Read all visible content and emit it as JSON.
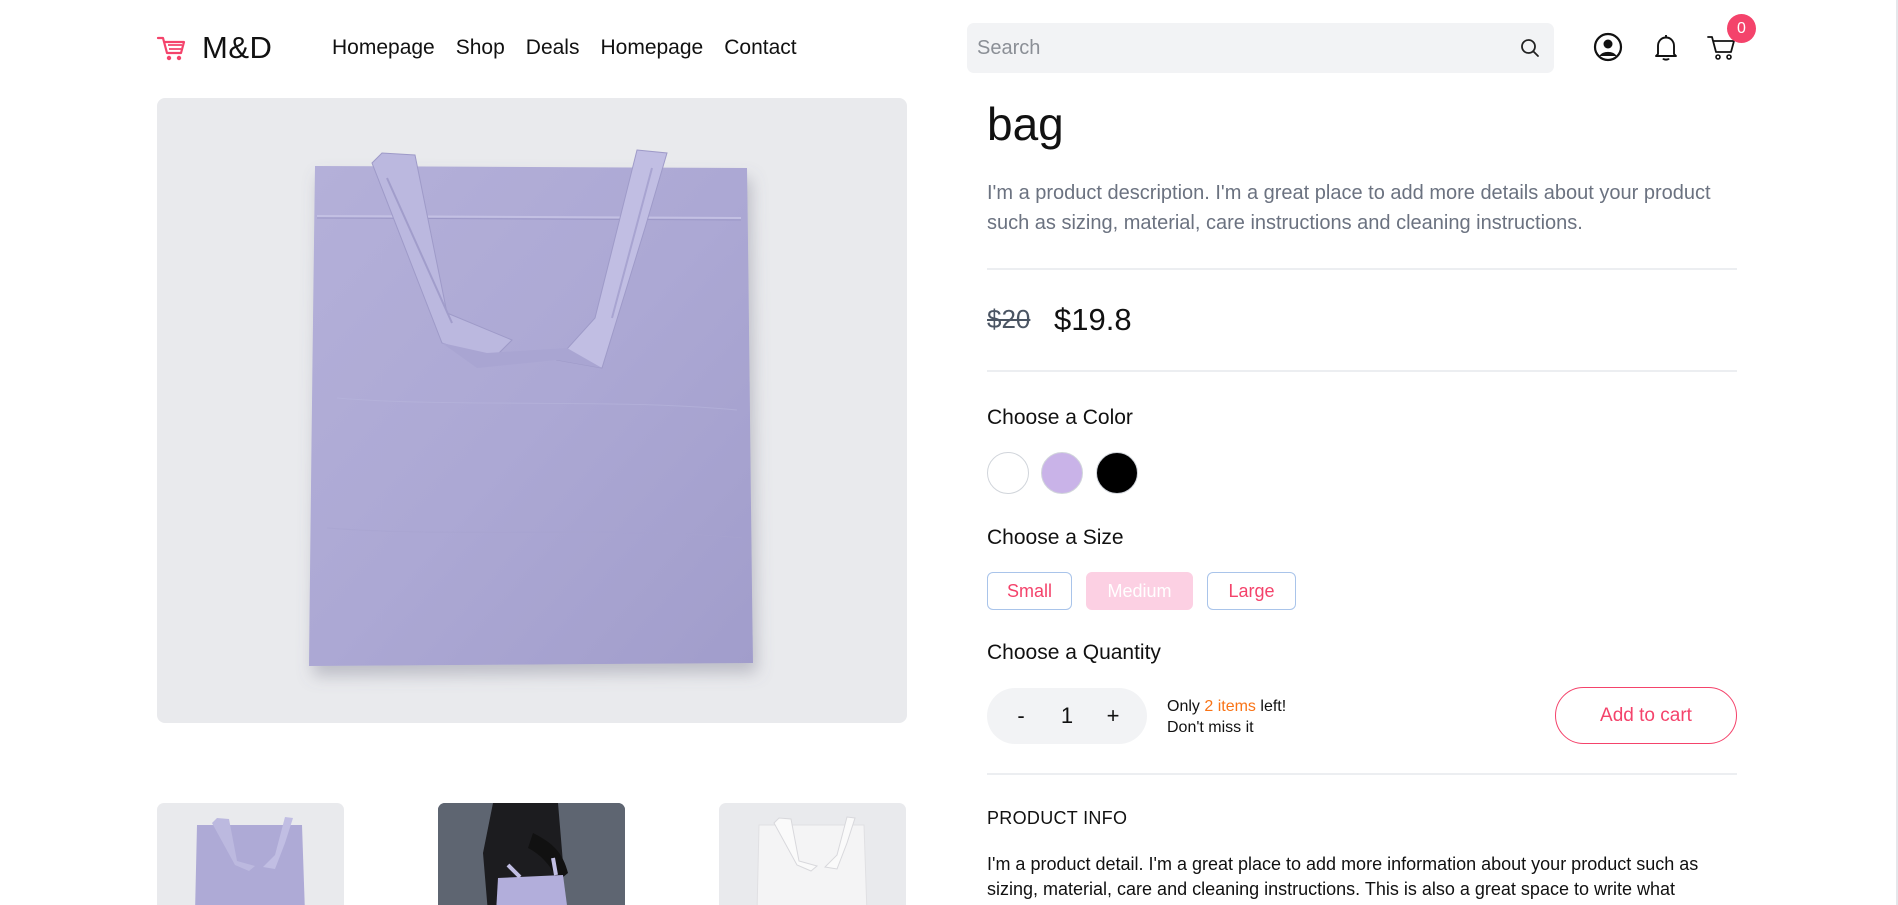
{
  "brand": {
    "name": "M&D",
    "icon": "shopping-cart-icon",
    "accent": "#f4436b"
  },
  "nav": {
    "items": [
      "Homepage",
      "Shop",
      "Deals",
      "Homepage",
      "Contact"
    ]
  },
  "search": {
    "placeholder": "Search",
    "value": "",
    "icon": "search-icon"
  },
  "header_icons": {
    "user": "user-circle-icon",
    "notifications": "bell-icon",
    "cart": "cart-icon",
    "cart_count": "0"
  },
  "product": {
    "title": "bag",
    "description": "I'm a product description. I'm a great place to add more details about your product such as sizing, material, care instructions and cleaning instructions.",
    "price_old": "$20",
    "price_new": "$19.8",
    "color_label": "Choose a Color",
    "colors": [
      "#ffffff",
      "#c9b3e8",
      "#000000"
    ],
    "size_label": "Choose a Size",
    "sizes": [
      "Small",
      "Medium",
      "Large"
    ],
    "quantity_label": "Choose a Quantity",
    "quantity": {
      "minus": "-",
      "value": "1",
      "plus": "+"
    },
    "stock": {
      "only": "Only",
      "count": "2 items",
      "left": "left!",
      "note": "Don't miss it"
    },
    "add_to_cart": "Add to cart",
    "info_title": "PRODUCT INFO",
    "info_text": "I'm a product detail. I'm a great place to add more information about your product such as sizing, material, care and cleaning instructions. This is also a great space to write what"
  },
  "images": {
    "main": "lavender-tote-bag",
    "thumbs": [
      "lavender-tote-bag",
      "person-holding-tote",
      "white-tote-bag"
    ]
  }
}
